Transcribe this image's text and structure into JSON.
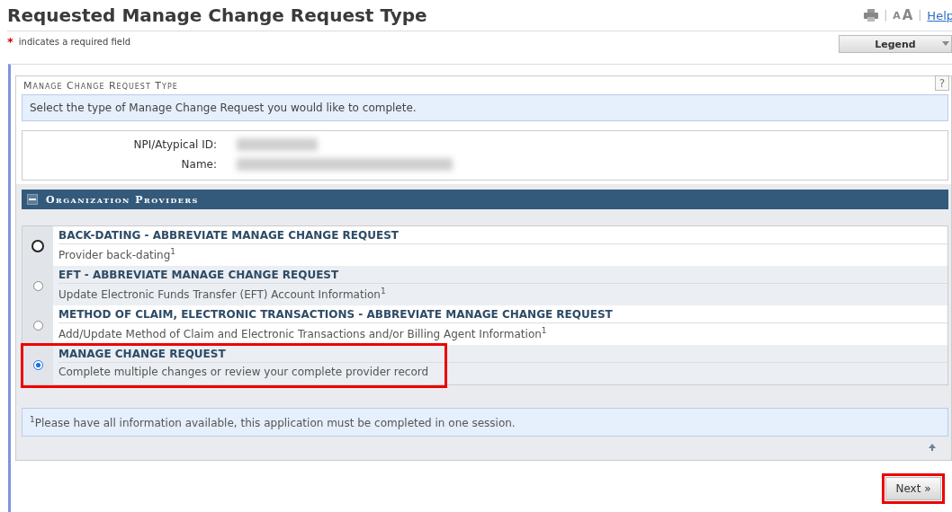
{
  "page_title": "Requested Manage Change Request Type",
  "toolbar": {
    "separator_1": "|",
    "font_size_small": "A",
    "font_size_large": "A",
    "separator_2": "|",
    "help_link": "Help"
  },
  "required_note": {
    "marker": "*",
    "text": "indicates a required field"
  },
  "legend_button": {
    "label": "Legend"
  },
  "fieldset": {
    "legend": "Manage Change Request Type",
    "help_button": "?",
    "instruction": "Select the type of Manage Change Request you would like to complete.",
    "fields": [
      {
        "label": "NPI/Atypical ID:",
        "blurred": true
      },
      {
        "label": "Name:",
        "blurred": true
      }
    ],
    "section": {
      "title": "Organization Providers",
      "expanded": true,
      "options": [
        {
          "title": "BACK-DATING - ABBREVIATE MANAGE CHANGE REQUEST",
          "description": "Provider back-dating$^{1}$",
          "selected": false,
          "focused": true,
          "highlighted": false
        },
        {
          "title": "EFT - ABBREVIATE MANAGE CHANGE REQUEST",
          "description": "Update Electronic Funds Transfer (EFT) Account Information$^{1}$",
          "selected": false,
          "focused": false,
          "highlighted": false
        },
        {
          "title": "METHOD OF CLAIM, ELECTRONIC TRANSACTIONS - ABBREVIATE MANAGE CHANGE REQUEST",
          "description": "Add/Update Method of Claim and Electronic Transactions and/or Billing Agent Information$^{1}$",
          "selected": false,
          "focused": false,
          "highlighted": false
        },
        {
          "title": "MANAGE CHANGE REQUEST",
          "description": "Complete multiple changes or review your complete provider record",
          "selected": true,
          "focused": false,
          "highlighted": true
        }
      ]
    },
    "footnote": "$^{1}$Please have all information available, this application must be completed in one session."
  },
  "next_button": {
    "label": "Next »",
    "highlighted": true
  }
}
